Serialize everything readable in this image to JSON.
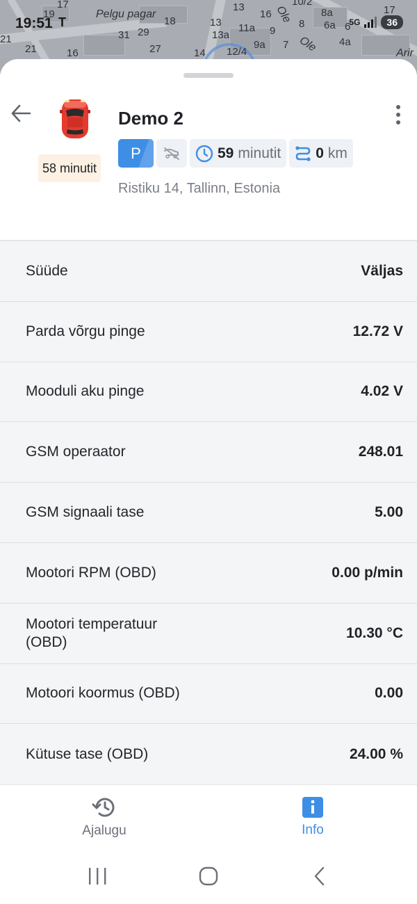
{
  "status_bar": {
    "time": "19:51",
    "battery": "36"
  },
  "map": {
    "street_1": "Pelgu pagar",
    "street_2": "Ole",
    "street_3": "Arir",
    "numbers": [
      "17",
      "19",
      "13",
      "16",
      "10/2",
      "17",
      "8a",
      "18",
      "31",
      "29",
      "13",
      "11a",
      "9",
      "8",
      "6a",
      "6",
      "13a",
      "27",
      "14",
      "12/4",
      "9a",
      "7",
      "4a",
      "21",
      "21",
      "16"
    ]
  },
  "vehicle": {
    "name": "Demo 2",
    "since": "58 minutit",
    "status_letter": "P",
    "duration_value": "59",
    "duration_unit": "minutit",
    "distance_value": "0",
    "distance_unit": "km",
    "address": "Ristiku 14, Tallinn, Estonia",
    "status_color": "#3f8ee6"
  },
  "info_rows": [
    {
      "label": "Süüde",
      "value": "Väljas"
    },
    {
      "label": "Parda võrgu pinge",
      "value": "12.72 V"
    },
    {
      "label": "Mooduli aku pinge",
      "value": "4.02 V"
    },
    {
      "label": "GSM operaator",
      "value": "248.01"
    },
    {
      "label": "GSM signaali tase",
      "value": "5.00"
    },
    {
      "label": "Mootori RPM (OBD)",
      "value": "0.00 p/min"
    },
    {
      "label": "Mootori temperatuur (OBD)",
      "value": "10.30 °C"
    },
    {
      "label": "Motoori koormus (OBD)",
      "value": "0.00"
    },
    {
      "label": "Kütuse tase (OBD)",
      "value": "24.00 %"
    }
  ],
  "bottom_nav": {
    "history_label": "Ajalugu",
    "info_label": "Info",
    "active": "info"
  },
  "icons": {
    "back": "arrow-left-icon",
    "car": "car-icon",
    "more": "more-vertical-icon",
    "ignition": "ignition-off-icon",
    "clock": "clock-icon",
    "route": "route-icon",
    "history": "history-icon",
    "info": "info-icon"
  }
}
